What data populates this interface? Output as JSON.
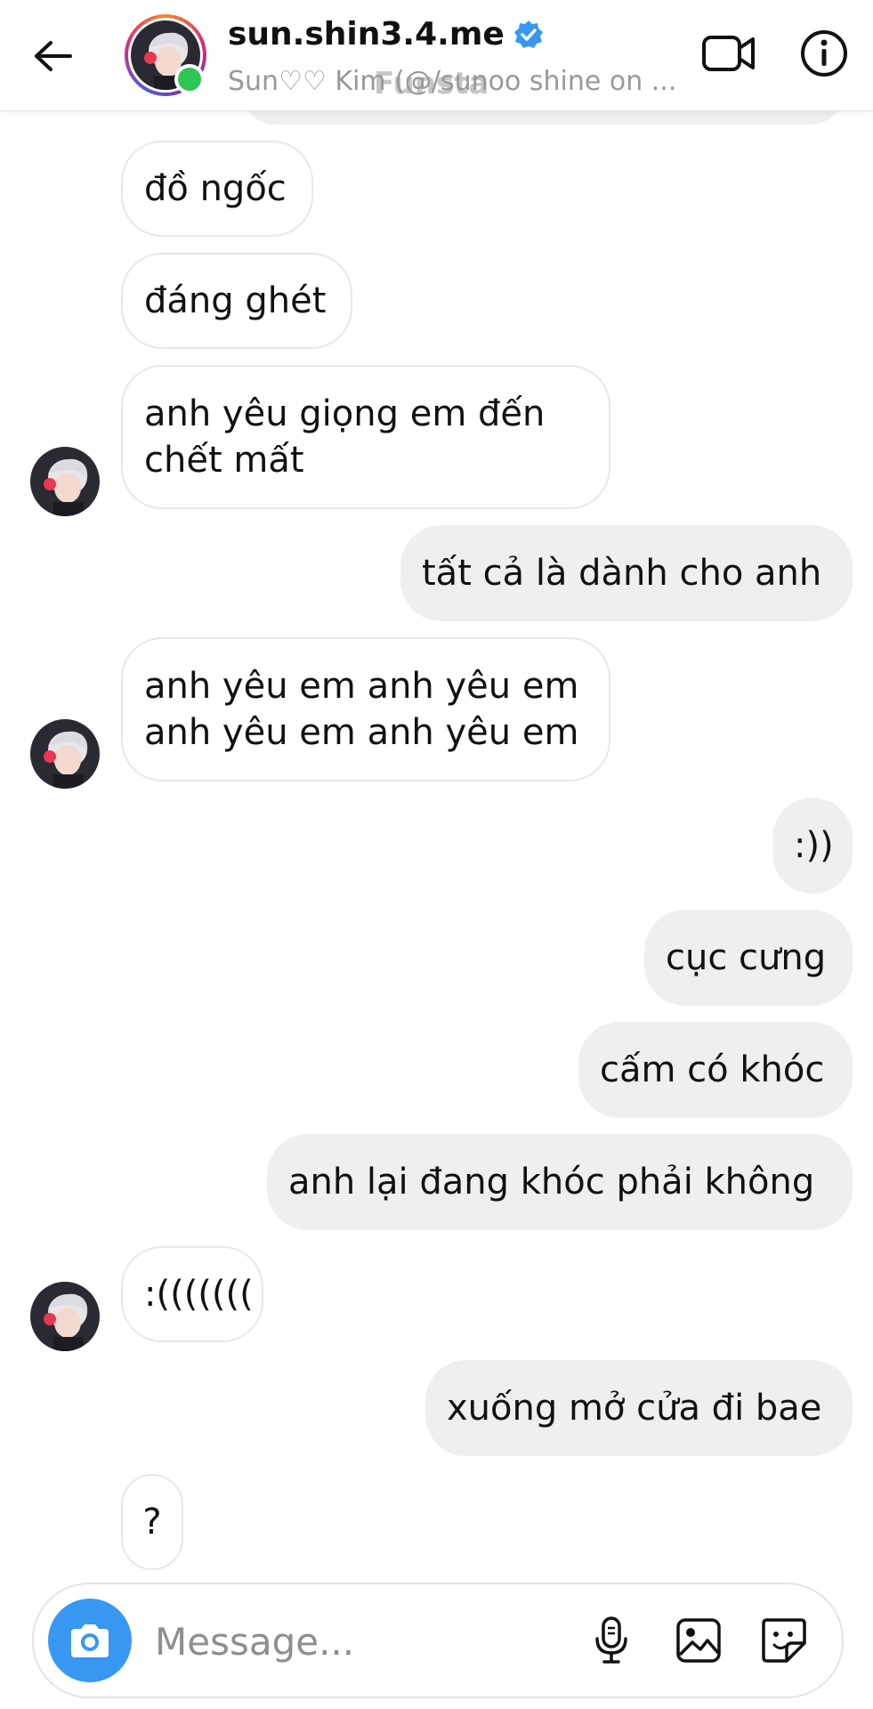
{
  "header": {
    "username": "sun.shin3.4.me",
    "subtitle": "Sun♡♡ Kim (@/sunoo shine on ...",
    "watermark": "Funsta",
    "verified": true,
    "online": true
  },
  "avatar": {
    "icon": "profile-photo",
    "accent": "#e7394f"
  },
  "messages": [
    {
      "from": "them",
      "text": "đồ ngốc"
    },
    {
      "from": "them",
      "text": "đáng ghét"
    },
    {
      "from": "them",
      "lines": [
        "anh yêu giọng em đến",
        "chết mất"
      ]
    },
    {
      "from": "me",
      "text": "tất cả là dành cho anh"
    },
    {
      "from": "them",
      "lines": [
        "anh yêu em anh yêu em",
        "anh yêu em anh yêu em"
      ]
    },
    {
      "from": "me",
      "text": ":))"
    },
    {
      "from": "me",
      "text": "cục cưng"
    },
    {
      "from": "me",
      "text": "cấm có khóc"
    },
    {
      "from": "me",
      "text": "anh lại đang khóc phải không"
    },
    {
      "from": "them",
      "text": ":((((((("
    },
    {
      "from": "me",
      "text": "xuống mở cửa đi bae"
    },
    {
      "from": "them",
      "text": "?"
    }
  ],
  "composer": {
    "placeholder": "Message...",
    "value": ""
  },
  "colors": {
    "sent_bubble": "#efefef",
    "received_border": "#e8e8e8",
    "camera_button": "#3897f0",
    "online": "#2dc653",
    "verified": "#3897f0"
  }
}
